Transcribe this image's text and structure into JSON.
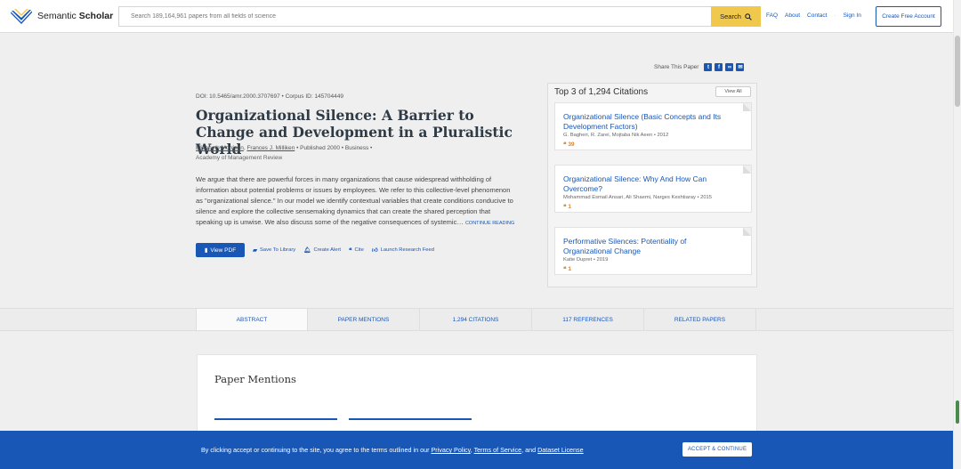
{
  "header": {
    "logo_text_regular": "Semantic ",
    "logo_text_bold": "Scholar",
    "search_placeholder": "Search 189,164,961 papers from all fields of science",
    "search_button": "Search",
    "nav": [
      "FAQ",
      "About",
      "Contact",
      "Sign In"
    ],
    "create_account": "Create Free Account"
  },
  "share": {
    "label": "Share This Paper",
    "icons": [
      "twitter-icon",
      "facebook-icon",
      "link-icon",
      "email-icon"
    ]
  },
  "paper": {
    "doi_line": "DOI: 10.5465/amr.2000.3707697  •  Corpus ID: 145704449",
    "title": "Organizational Silence: A Barrier to Change and Development in a Pluralistic World",
    "author1": "Elizabeth Morrison",
    "author2": "Frances J. Milliken",
    "published": " •  Published 2000  •  Business  •",
    "journal": "Academy of Management Review",
    "abstract": "We argue that there are powerful forces in many organizations that cause widespread withholding of information about potential problems or issues by employees. We refer to this collective-level phenomenon as \"organizational silence.\" In our model we identify contextual variables that create conditions conducive to silence and explore the collective sensemaking dynamics that can create the shared perception that speaking up is unwise. We also discuss some of the negative consequences of systemic…",
    "continue_reading": "CONTINUE READING"
  },
  "actions": {
    "view_pdf": "View PDF",
    "save": "Save To Library",
    "alert": "Create Alert",
    "cite": "Cite",
    "feed": "Launch Research Feed"
  },
  "citations": {
    "heading": "Top 3 of 1,294 Citations",
    "view_all": "View All",
    "items": [
      {
        "title": "Organizational Silence (Basic Concepts and Its Development Factors)",
        "authors": "G. Bagheri, R. Zarei, Mojtaba Nik Aeen  •  2012",
        "count": "39"
      },
      {
        "title": "Organizational Silence: Why And How Can Overcome?",
        "authors": "Mohammad Esmail Ansari, Ali Shaemi, Narges Keshtiaray  •  2015",
        "count": "1"
      },
      {
        "title": "Performative Silences: Potentiality of Organizational Change",
        "authors": "Katie Dupret  •  2019",
        "count": "1"
      }
    ]
  },
  "tabs": [
    "ABSTRACT",
    "PAPER MENTIONS",
    "1,294 CITATIONS",
    "117 REFERENCES",
    "RELATED PAPERS"
  ],
  "mentions": {
    "title": "Paper Mentions"
  },
  "cookie": {
    "text_before": "By clicking accept or continuing to the site, you agree to the terms outlined in our ",
    "privacy": "Privacy Policy",
    "comma": ", ",
    "terms": "Terms of Service",
    "and": ", and ",
    "dataset": "Dataset License",
    "accept": "ACCEPT & CONTINUE"
  },
  "colors": {
    "accent": "#1857b6",
    "search_button": "#f0c84b",
    "citation_count": "#d9822b"
  }
}
